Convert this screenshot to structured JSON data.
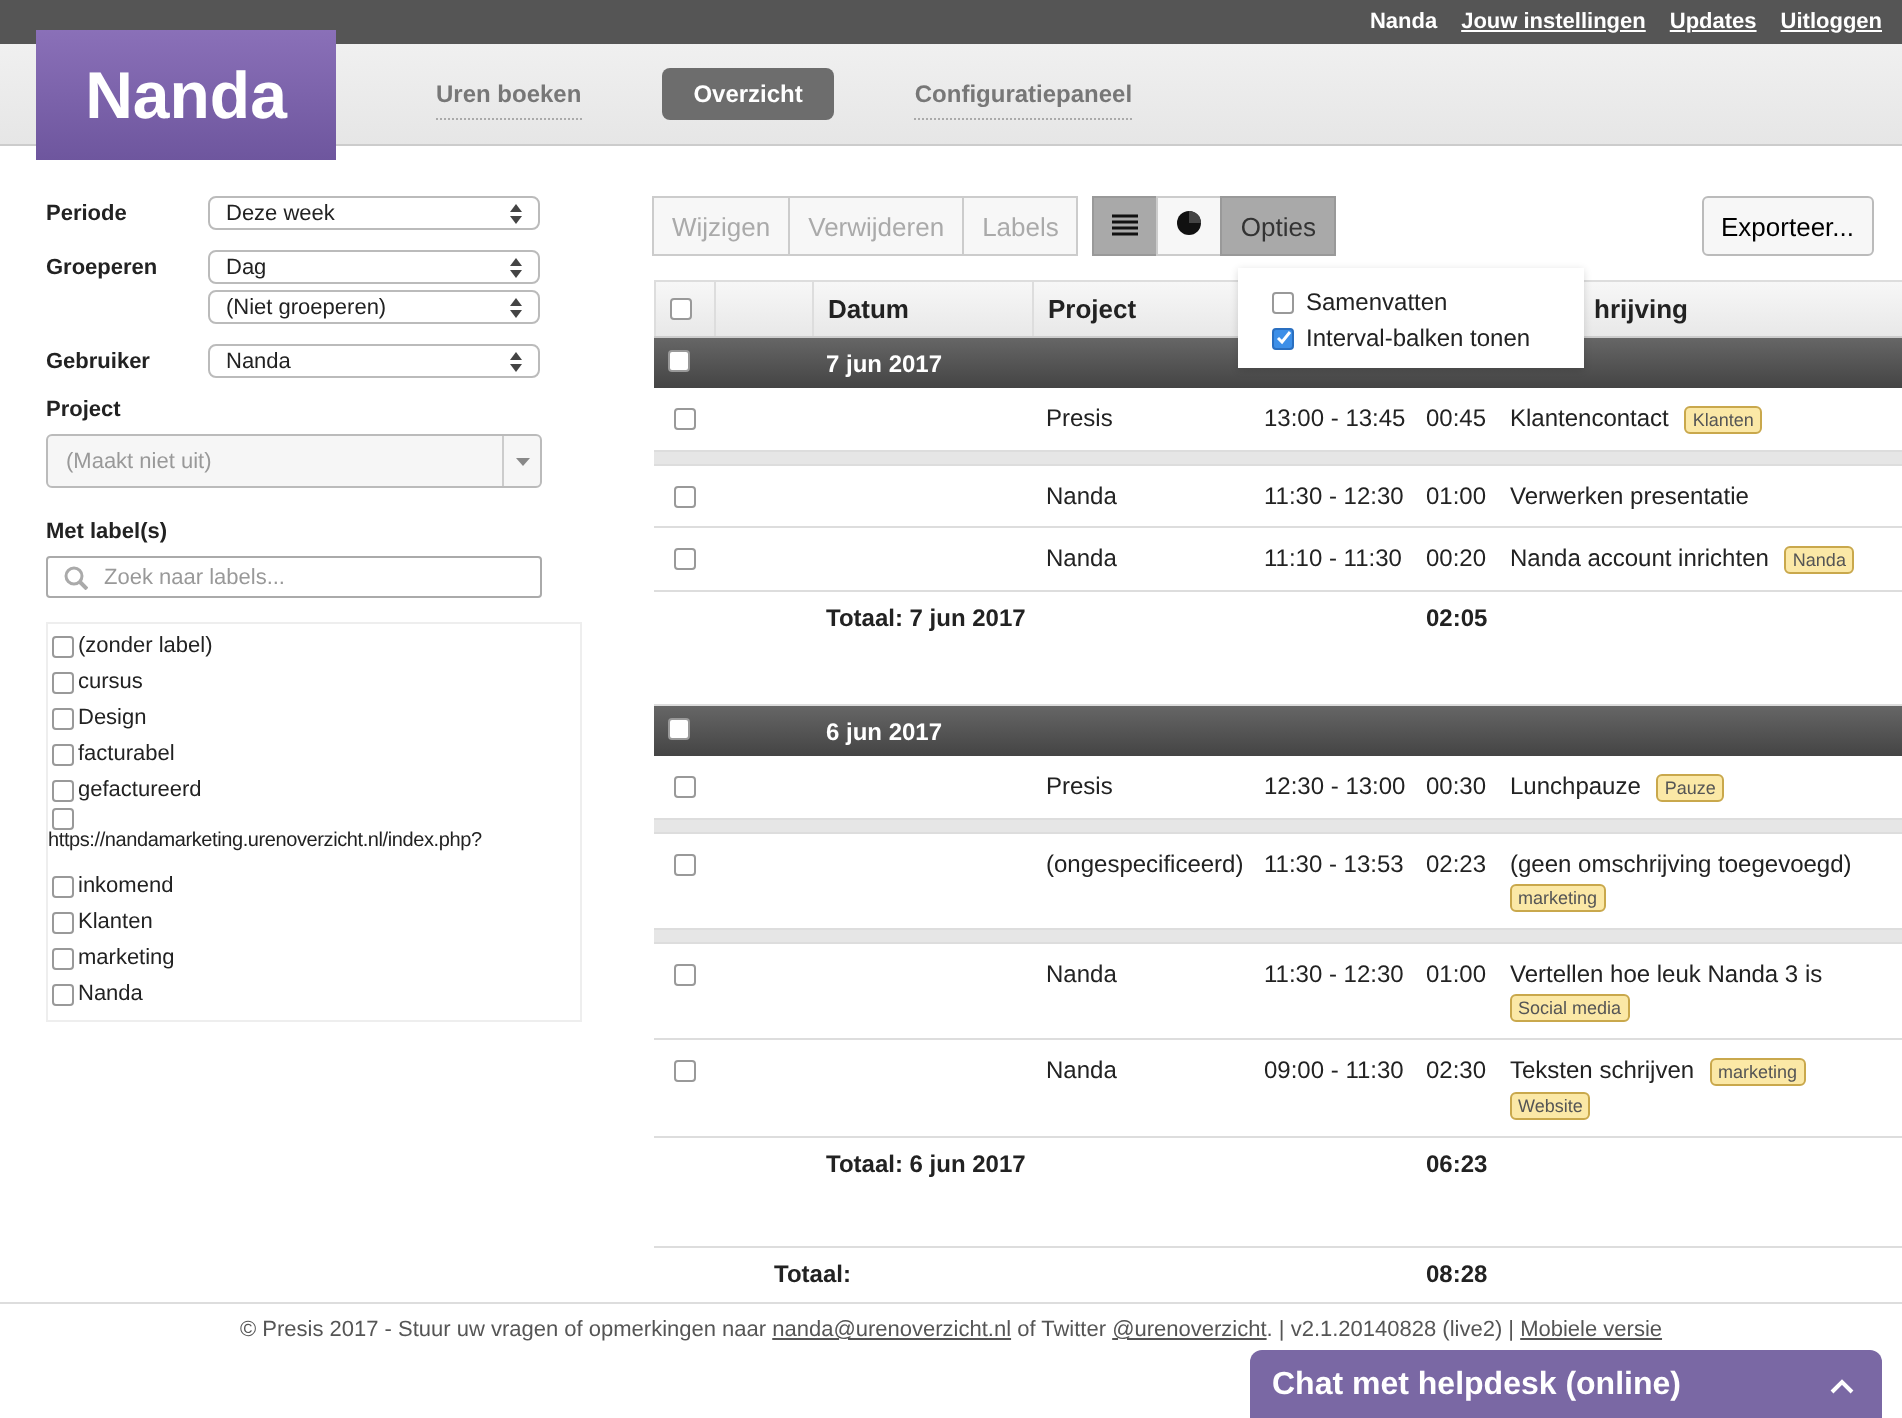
{
  "top_bar": {
    "user": "Nanda",
    "links": [
      "Jouw instellingen",
      "Updates",
      "Uitloggen"
    ]
  },
  "logo": "Nanda",
  "nav": [
    {
      "label": "Uren boeken",
      "selected": false
    },
    {
      "label": "Overzicht",
      "selected": true
    },
    {
      "label": "Configuratiepaneel",
      "selected": false
    }
  ],
  "filters": [
    {
      "label": "Periode",
      "selects": [
        "Deze week"
      ]
    },
    {
      "label": "Groeperen",
      "selects": [
        "Dag",
        "(Niet groeperen)"
      ]
    },
    {
      "label": "Gebruiker",
      "selects": [
        "Nanda"
      ]
    }
  ],
  "project": {
    "label": "Project",
    "placeholder": "(Maakt niet uit)"
  },
  "labels_filter": {
    "label": "Met label(s)",
    "search_placeholder": "Zoek naar labels...",
    "items": [
      {
        "text": "(zonder label)",
        "checked": false
      },
      {
        "text": "cursus",
        "checked": false
      },
      {
        "text": "Design",
        "checked": false
      },
      {
        "text": "facturabel",
        "checked": false
      },
      {
        "text": "gefactureerd",
        "checked": false
      },
      {
        "text": "https://nandamarketing.urenoverzicht.nl/index.php?",
        "checked": false,
        "kind": "long"
      },
      {
        "text": "inkomend",
        "checked": false
      },
      {
        "text": "Klanten",
        "checked": false
      },
      {
        "text": "marketing",
        "checked": false
      },
      {
        "text": "Nanda",
        "checked": false
      }
    ]
  },
  "toolbar": {
    "actions": [
      {
        "label": "Wijzigen",
        "disabled": true
      },
      {
        "label": "Verwijderen",
        "disabled": true
      },
      {
        "label": "Labels",
        "disabled": true
      }
    ],
    "views": [
      {
        "kind": "list",
        "selected": true
      },
      {
        "kind": "pie",
        "selected": false
      },
      {
        "kind": "text",
        "label": "Opties",
        "selected": true
      }
    ],
    "export": "Exporteer..."
  },
  "options_menu": [
    {
      "label": "Samenvatten",
      "checked": false
    },
    {
      "label": "Interval-balken tonen",
      "checked": true
    }
  ],
  "table": {
    "columns": [
      "Datum",
      "Project",
      "hrijving"
    ],
    "header_checked": false,
    "groups": [
      {
        "date": "7 jun 2017",
        "checked": false,
        "total_label": "Totaal: 7 jun 2017",
        "total": "02:05",
        "rows": [
          {
            "checked": false,
            "project": "Presis",
            "interval": "13:00 - 13:45",
            "duration": "00:45",
            "description": "Klantencontact",
            "labels": [
              "Klanten"
            ],
            "gap_after": true
          },
          {
            "checked": false,
            "project": "Nanda",
            "interval": "11:30 - 12:30",
            "duration": "01:00",
            "description": "Verwerken presentatie",
            "labels": [],
            "gap_after": false
          },
          {
            "checked": false,
            "project": "Nanda",
            "interval": "11:10 - 11:30",
            "duration": "00:20",
            "description": "Nanda account inrichten",
            "labels": [
              "Nanda"
            ],
            "gap_after": false
          }
        ]
      },
      {
        "date": "6 jun 2017",
        "checked": false,
        "total_label": "Totaal: 6 jun 2017",
        "total": "06:23",
        "rows": [
          {
            "checked": false,
            "project": "Presis",
            "interval": "12:30 - 13:00",
            "duration": "00:30",
            "description": "Lunchpauze",
            "labels": [
              "Pauze"
            ],
            "gap_after": true
          },
          {
            "checked": false,
            "project": "(ongespecificeerd)",
            "interval": "11:30 - 13:53",
            "duration": "02:23",
            "description": "(geen omschrijving toegevoegd)",
            "labels": [
              "marketing"
            ],
            "gap_after": true
          },
          {
            "checked": false,
            "project": "Nanda",
            "interval": "11:30 - 12:30",
            "duration": "01:00",
            "description": "Vertellen hoe leuk Nanda 3 is",
            "labels": [
              "Social media"
            ],
            "gap_after": false
          },
          {
            "checked": false,
            "project": "Nanda",
            "interval": "09:00 - 11:30",
            "duration": "02:30",
            "description": "Teksten schrijven",
            "labels": [
              "marketing",
              "Website"
            ],
            "gap_after": false
          }
        ]
      }
    ],
    "grand_total_label": "Totaal:",
    "grand_total": "08:28"
  },
  "footer": {
    "prefix": "© Presis 2017 - Stuur uw vragen of opmerkingen naar",
    "email": "nanda@urenoverzicht.nl",
    "middle": "of Twitter",
    "twitter": "@urenoverzicht",
    "suffix": ". | v2.1.20140828 (live2) |",
    "mobile": "Mobiele versie"
  },
  "chat": {
    "label": "Chat met helpdesk (online)",
    "expanded": false
  }
}
